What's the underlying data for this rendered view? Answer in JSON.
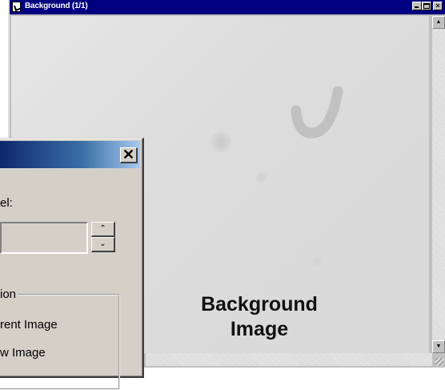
{
  "background_window": {
    "title": "Background (1/1)",
    "overlay_label_line1": "Background",
    "overlay_label_line2": "Image"
  },
  "dialog": {
    "label": "el:",
    "close_glyph": "✕",
    "spin_up_glyph": "⌃",
    "spin_down_glyph": "⌄",
    "group_title": "ion",
    "option_current": "rent Image",
    "option_new": "w Image"
  },
  "colors": {
    "title_bar": "#000080",
    "window_face": "#d4d0c8",
    "image_background": "#dcdcdc"
  }
}
